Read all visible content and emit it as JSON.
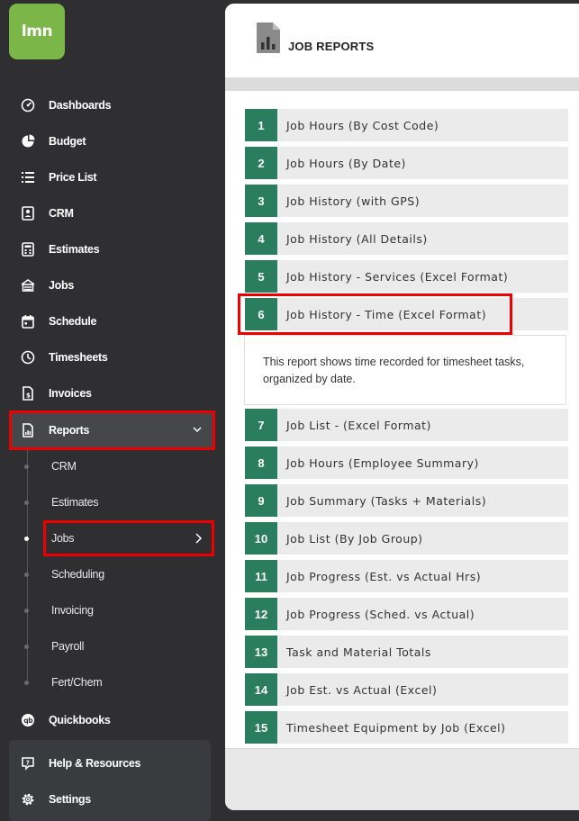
{
  "app": {
    "logo_text": "lmn",
    "brand_color": "#7ab648",
    "accent": "#2a7d5f",
    "highlight": "#e00000"
  },
  "sidebar": {
    "items": [
      {
        "label": "Dashboards",
        "icon": "dashboard-icon"
      },
      {
        "label": "Budget",
        "icon": "pie-chart-icon"
      },
      {
        "label": "Price List",
        "icon": "list-icon"
      },
      {
        "label": "CRM",
        "icon": "contact-card-icon"
      },
      {
        "label": "Estimates",
        "icon": "calculator-icon"
      },
      {
        "label": "Jobs",
        "icon": "jobs-icon"
      },
      {
        "label": "Schedule",
        "icon": "calendar-icon"
      },
      {
        "label": "Timesheets",
        "icon": "clock-icon"
      },
      {
        "label": "Invoices",
        "icon": "invoice-icon"
      },
      {
        "label": "Reports",
        "icon": "report-icon"
      }
    ],
    "reports_submenu": [
      "CRM",
      "Estimates",
      "Jobs",
      "Scheduling",
      "Invoicing",
      "Payroll",
      "Fert/Chem"
    ],
    "quickbooks": "Quickbooks",
    "help": "Help & Resources",
    "settings": "Settings"
  },
  "main": {
    "title": "JOB REPORTS",
    "reports": [
      {
        "num": "1",
        "title": "Job Hours (By Cost Code)"
      },
      {
        "num": "2",
        "title": "Job Hours (By Date)"
      },
      {
        "num": "3",
        "title": "Job History (with GPS)"
      },
      {
        "num": "4",
        "title": "Job History (All Details)"
      },
      {
        "num": "5",
        "title": "Job History - Services (Excel Format)"
      },
      {
        "num": "6",
        "title": "Job History - Time (Excel Format)"
      },
      {
        "num": "7",
        "title": "Job List - (Excel Format)"
      },
      {
        "num": "8",
        "title": "Job Hours (Employee Summary)"
      },
      {
        "num": "9",
        "title": "Job Summary (Tasks + Materials)"
      },
      {
        "num": "10",
        "title": "Job List (By Job Group)"
      },
      {
        "num": "11",
        "title": "Job Progress (Est. vs Actual Hrs)"
      },
      {
        "num": "12",
        "title": "Job Progress (Sched. vs Actual)"
      },
      {
        "num": "13",
        "title": "Task and Material Totals"
      },
      {
        "num": "14",
        "title": "Job Est. vs Actual (Excel)"
      },
      {
        "num": "15",
        "title": "Timesheet Equipment by Job (Excel)"
      }
    ],
    "expanded_description": "This report shows time recorded for timesheet tasks, organized by date."
  }
}
